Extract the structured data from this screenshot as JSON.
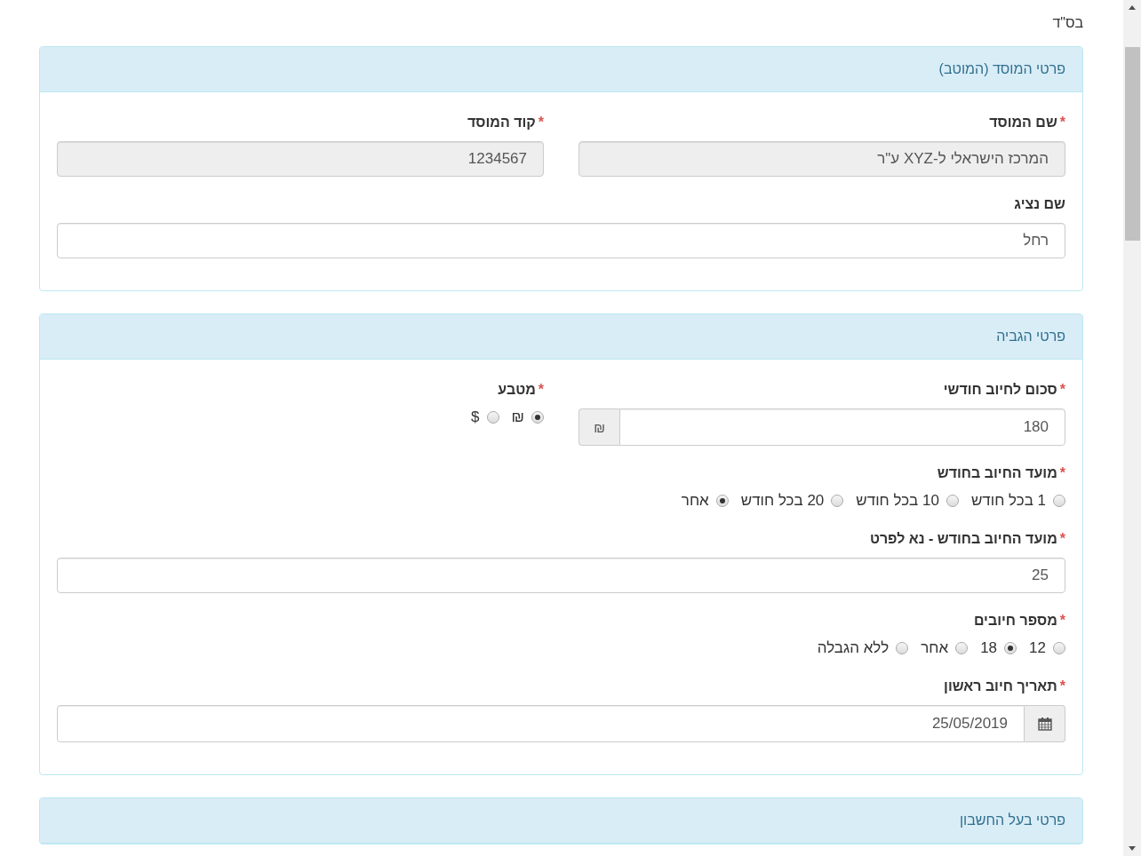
{
  "header_note": "בס\"ד",
  "panels": [
    {
      "title": "פרטי המוסד (המוטב)",
      "rows": [
        [
          {
            "kind": "text",
            "label": "שם המוסד",
            "required_mark": "*",
            "value": "המרכז הישראלי ל-XYZ ע\"ר",
            "readonly": true
          },
          {
            "kind": "text",
            "label": "קוד המוסד",
            "required_mark": "*",
            "value": "1234567",
            "readonly": true
          }
        ],
        [
          {
            "kind": "text",
            "label": "שם נציג",
            "value": "רחל",
            "readonly": false
          }
        ]
      ]
    },
    {
      "title": "פרטי הגביה",
      "rows": [
        [
          {
            "kind": "addon",
            "label": "סכום לחיוב חודשי",
            "required_mark": "*",
            "value": "180",
            "addon": "₪",
            "readonly": false
          },
          {
            "kind": "radio",
            "label": "מטבע",
            "required_mark": "*",
            "options": [
              {
                "label": "₪",
                "selected": true
              },
              {
                "label": "$",
                "selected": false
              }
            ]
          }
        ],
        [
          {
            "kind": "radio",
            "label": "מועד החיוב בחודש",
            "required_mark": "*",
            "options": [
              {
                "label": "1 בכל חודש",
                "selected": false
              },
              {
                "label": "10 בכל חודש",
                "selected": false
              },
              {
                "label": "20 בכל חודש",
                "selected": false
              },
              {
                "label": "אחר",
                "selected": true
              }
            ]
          }
        ],
        [
          {
            "kind": "text",
            "label": "מועד החיוב בחודש - נא לפרט",
            "required_mark": "*",
            "value": "25",
            "readonly": false
          }
        ],
        [
          {
            "kind": "radio",
            "label": "מספר חיובים",
            "required_mark": "*",
            "options": [
              {
                "label": "12",
                "selected": false
              },
              {
                "label": "18",
                "selected": true
              },
              {
                "label": "אחר",
                "selected": false
              },
              {
                "label": "ללא הגבלה",
                "selected": false
              }
            ]
          }
        ],
        [
          {
            "kind": "date",
            "label": "תאריך חיוב ראשון",
            "required_mark": "*",
            "value": "25/05/2019",
            "readonly": false
          }
        ]
      ]
    },
    {
      "title": "פרטי בעל החשבון"
    }
  ]
}
